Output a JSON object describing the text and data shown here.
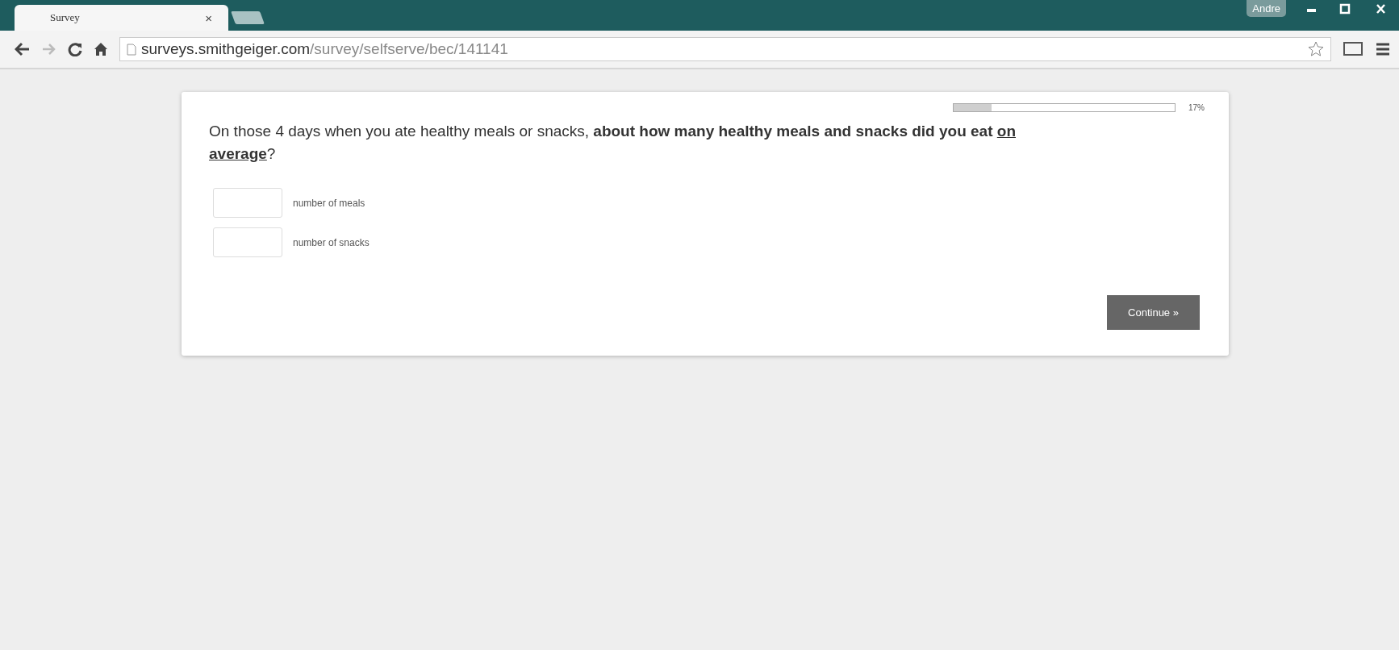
{
  "browser": {
    "tab": {
      "title": "Survey",
      "close": "×"
    },
    "profile": "Andre",
    "url": {
      "host": "surveys.smithgeiger.com",
      "path": "/survey/selfserve/bec/141141"
    }
  },
  "survey": {
    "progress": {
      "level": 0.17,
      "reading": "17%"
    },
    "question": [
      {
        "kind": "plain",
        "text": "On those 4 days when you ate healthy meals or snacks, "
      },
      {
        "kind": "bold",
        "text": "about how many healthy meals and snacks did you eat "
      },
      {
        "kind": "underlined",
        "text": "on average"
      },
      {
        "kind": "plain",
        "text": "?"
      }
    ],
    "fields": [
      {
        "label": "number of meals"
      },
      {
        "label": "number of snacks"
      }
    ],
    "continue": "Continue »"
  }
}
